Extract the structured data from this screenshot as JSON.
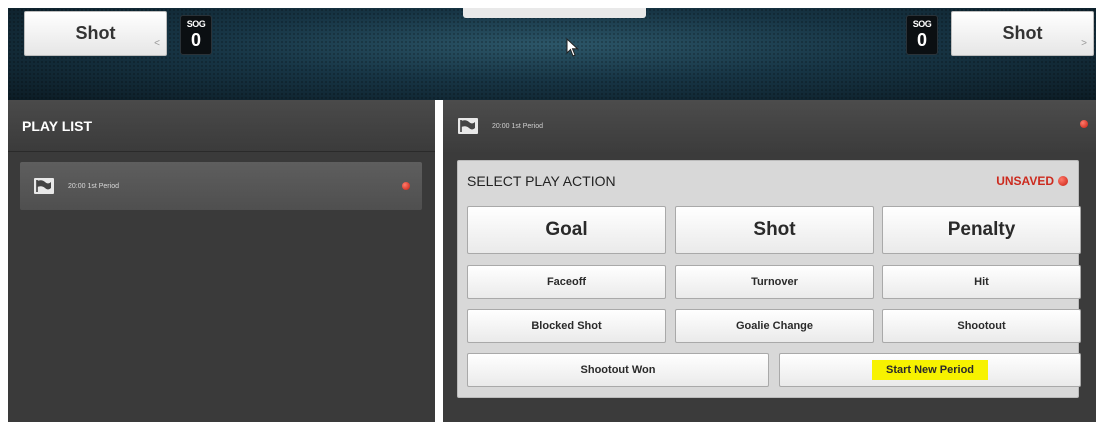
{
  "scoreboard": {
    "left_shot_label": "Shot",
    "left_sog_label": "SOG",
    "left_sog_value": "0",
    "right_shot_label": "Shot",
    "right_sog_label": "SOG",
    "right_sog_value": "0",
    "left_chevron": "<",
    "right_chevron": ">"
  },
  "playlist": {
    "title": "PLAY LIST",
    "items": [
      {
        "label": "20:00 1st Period"
      }
    ]
  },
  "detail": {
    "header_label": "20:00 1st Period",
    "select_title": "SELECT PLAY ACTION",
    "status": "UNSAVED",
    "actions": {
      "goal": "Goal",
      "shot": "Shot",
      "penalty": "Penalty",
      "faceoff": "Faceoff",
      "turnover": "Turnover",
      "hit": "Hit",
      "blocked_shot": "Blocked Shot",
      "goalie_change": "Goalie Change",
      "shootout": "Shootout",
      "shootout_won": "Shootout Won",
      "start_new_period": "Start New Period"
    }
  },
  "colors": {
    "accent_red": "#cc2a1e",
    "highlight_yellow": "#f7f200",
    "panel_dark": "#3a3a3a"
  },
  "icons": {
    "play_flag": "flag-icon",
    "status_dot": "red-dot-icon",
    "cursor": "cursor-icon"
  }
}
